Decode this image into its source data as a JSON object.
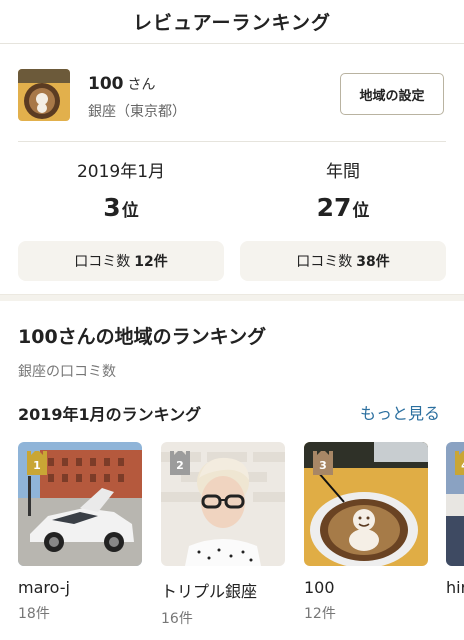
{
  "header": {
    "title": "レビュアーランキング"
  },
  "profile": {
    "name": "100",
    "suffix": "さん",
    "area": "銀座（東京都）",
    "area_button": "地域の設定"
  },
  "stats": [
    {
      "period": "2019年1月",
      "rank": "3",
      "rank_unit": "位",
      "review_label": "口コミ数",
      "review_count": "12件"
    },
    {
      "period": "年間",
      "rank": "27",
      "rank_unit": "位",
      "review_label": "口コミ数",
      "review_count": "38件"
    }
  ],
  "region": {
    "title": "100さんの地域のランキング",
    "subtitle": "銀座の口コミ数",
    "month_title": "2019年1月のランキング",
    "more_link": "もっと見る"
  },
  "ranking": [
    {
      "rank": "1",
      "name": "maro-j",
      "count": "18件",
      "badge_color": "#c9a635"
    },
    {
      "rank": "2",
      "name": "トリプル銀座",
      "count": "16件",
      "badge_color": "#9c9c9c"
    },
    {
      "rank": "3",
      "name": "100",
      "count": "12件",
      "badge_color": "#a88766"
    },
    {
      "rank": "4",
      "name": "hir",
      "count": "",
      "badge_color": "#c9a635"
    }
  ]
}
